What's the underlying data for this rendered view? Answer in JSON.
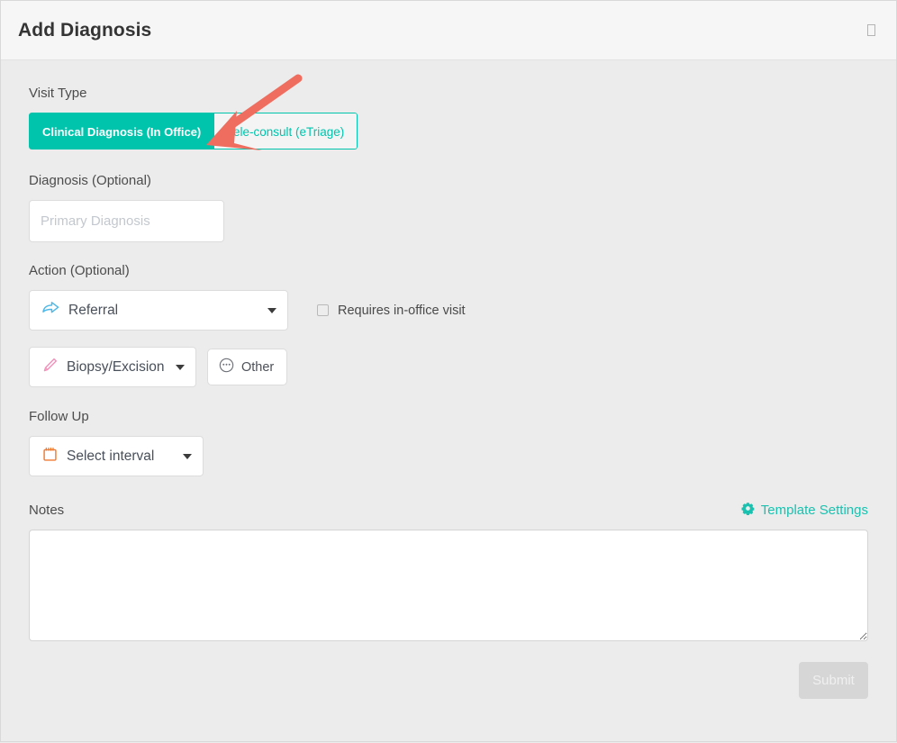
{
  "header": {
    "title": "Add Diagnosis",
    "close_icon": "close-icon",
    "close_glyph": ""
  },
  "form": {
    "visit_type": {
      "label": "Visit Type",
      "options": [
        {
          "label": "Clinical Diagnosis (In Office)",
          "selected": true
        },
        {
          "label": "Tele-consult (eTriage)",
          "selected": false
        }
      ]
    },
    "diagnosis": {
      "label": "Diagnosis (Optional)",
      "placeholder": "Primary Diagnosis",
      "value": ""
    },
    "action": {
      "label": "Action (Optional)",
      "referral_select": {
        "value": "Referral",
        "icon": "share-arrow-icon"
      },
      "biopsy_select": {
        "value": "Biopsy/Excision",
        "icon": "scalpel-icon"
      },
      "other_button": {
        "label": "Other",
        "icon": "ellipsis-circle-icon"
      },
      "requires_visit_checkbox": {
        "label": "Requires in-office visit",
        "checked": false
      }
    },
    "follow_up": {
      "label": "Follow Up",
      "select": {
        "value": "Select interval",
        "icon": "calendar-icon"
      }
    },
    "notes": {
      "label": "Notes",
      "value": "",
      "template_settings": {
        "label": "Template Settings",
        "icon": "gear-icon"
      }
    },
    "submit": {
      "label": "Submit",
      "disabled": true
    }
  },
  "colors": {
    "accent_teal": "#00c4ac",
    "template_teal": "#19c2b0",
    "referral_blue": "#4db8e8",
    "biopsy_pink": "#f4a0c0",
    "calendar_orange": "#f07a30",
    "annotation_red": "#ef6d5f",
    "header_bg": "#f6f6f6",
    "body_bg": "#ececec"
  },
  "annotation": {
    "type": "arrow",
    "description": "red arrow pointing at Clinical Diagnosis (In Office) toggle"
  }
}
